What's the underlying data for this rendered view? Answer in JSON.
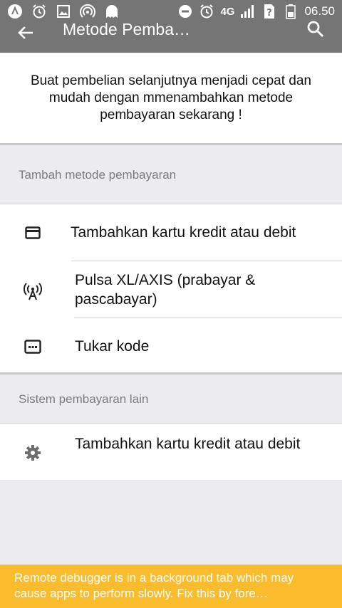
{
  "status_bar": {
    "network": "4G",
    "time": "06.50",
    "icons": [
      "app-icon",
      "alarm-icon",
      "image-icon",
      "hotspot-icon",
      "ghost-icon",
      "do-not-disturb-icon",
      "alarm-icon",
      "signal-icon",
      "unknown-sim-icon",
      "battery-icon"
    ]
  },
  "app_bar": {
    "title": "Metode Pemba…",
    "back_icon": "arrow-left-icon",
    "search_icon": "search-icon"
  },
  "intro": {
    "text": "Buat pembelian selanjutnya menjadi cepat dan mudah dengan mmenambahkan metode pembayaran sekarang !"
  },
  "sections": [
    {
      "header": "Tambah metode pembayaran",
      "items": [
        {
          "label": "Tambahkan kartu kredit atau debit",
          "icon": "credit-card-icon"
        },
        {
          "label": "Pulsa XL/AXIS (prabayar & pascabayar)",
          "icon": "cell-tower-icon"
        },
        {
          "label": "Tukar kode",
          "icon": "code-icon"
        }
      ]
    },
    {
      "header": "Sistem pembayaran lain",
      "items": [
        {
          "label": "Tambahkan kartu kredit atau debit",
          "icon": "settings-icon"
        }
      ]
    }
  ],
  "banner": {
    "text": "Remote debugger is in a background tab which may cause apps to perform slowly. Fix this by fore…",
    "color": "#f9bc2d"
  },
  "colors": {
    "app_bar": "#757575",
    "background": "#ececf0",
    "section_header_text": "#7a7a80"
  }
}
